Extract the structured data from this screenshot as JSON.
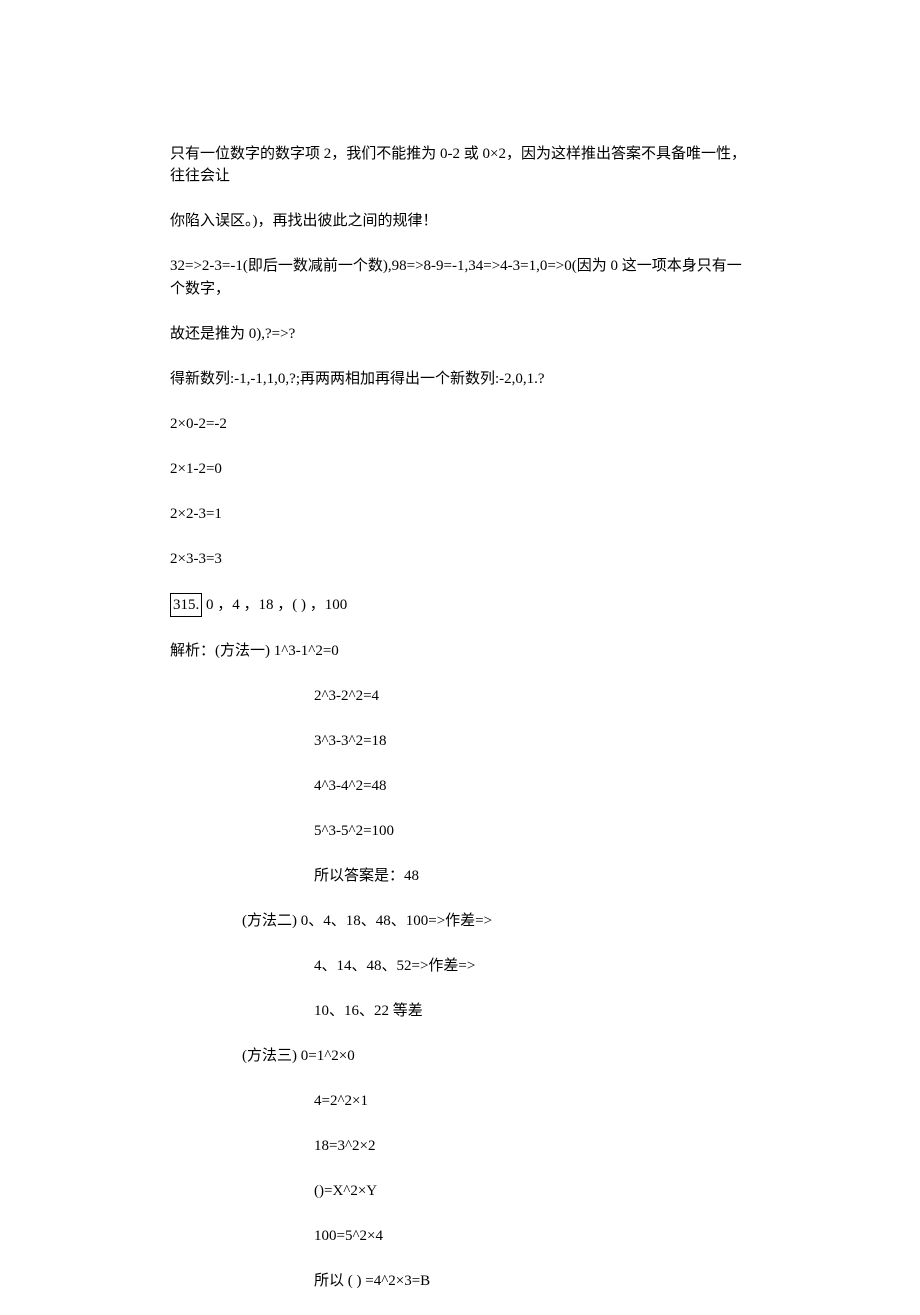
{
  "lines": {
    "l1": "只有一位数字的数字项 2，我们不能推为 0-2 或 0×2，因为这样推出答案不具备唯一性，往往会让",
    "l2": "你陷入误区。)，再找出彼此之间的规律！",
    "l3": "32=>2-3=-1(即后一数减前一个数),98=>8-9=-1,34=>4-3=1,0=>0(因为 0 这一项本身只有一个数字，",
    "l4": "故还是推为 0),?=>?",
    "l5": "得新数列:-1,-1,1,0,?;再两两相加再得出一个新数列:-2,0,1.?",
    "l6": "2×0-2=-2",
    "l7": "2×1-2=0",
    "l8": "2×2-3=1",
    "l9": "2×3-3=3",
    "q315": "315.",
    "l10b": " 0 ，4 ，18 ，( ) ，100",
    "l11": "解析：(方法一) 1^3-1^2=0",
    "l12": "2^3-2^2=4",
    "l13": "3^3-3^2=18",
    "l14": "4^3-4^2=48",
    "l15": "5^3-5^2=100",
    "l16": "所以答案是：48",
    "l17": "(方法二) 0、4、18、48、100=>作差=>",
    "l18": "4、14、48、52=>作差=>",
    "l19": "10、16、22 等差",
    "l20": "(方法三) 0=1^2×0",
    "l21": "4=2^2×1",
    "l22": "18=3^2×2",
    "l23": "()=X^2×Y",
    "l24": "100=5^2×4",
    "l25": "所以 ( ) =4^2×3=B"
  }
}
